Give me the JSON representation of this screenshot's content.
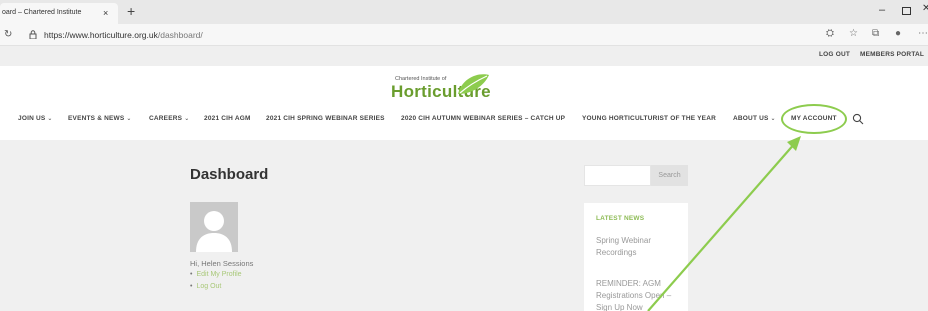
{
  "browser": {
    "tab_title": "oard – Chartered Institute",
    "tab_close": "×",
    "new_tab": "+",
    "url_host": "https://www.horticulture.org.uk",
    "url_path": "/dashboard/",
    "window_min": "–",
    "window_close": "✕"
  },
  "utility_nav": {
    "logout": "LOG OUT",
    "members_portal": "MEMBERS PORTAL"
  },
  "logo": {
    "small_text": "Chartered Institute of",
    "main_text": "Horticulture"
  },
  "main_nav": {
    "items": [
      {
        "label": "JOIN US",
        "chevron": "⌄"
      },
      {
        "label": "EVENTS & NEWS",
        "chevron": "⌄"
      },
      {
        "label": "CAREERS",
        "chevron": "⌄"
      },
      {
        "label": "2021 CIH AGM",
        "chevron": ""
      },
      {
        "label": "2021 CIH SPRING WEBINAR SERIES",
        "chevron": ""
      },
      {
        "label": "2020 CIH AUTUMN WEBINAR SERIES – CATCH UP",
        "chevron": ""
      },
      {
        "label": "YOUNG HORTICULTURIST OF THE YEAR",
        "chevron": ""
      },
      {
        "label": "ABOUT US",
        "chevron": "⌄"
      },
      {
        "label": "MY ACCOUNT",
        "chevron": ""
      }
    ]
  },
  "dashboard": {
    "title": "Dashboard",
    "greeting": "Hi, Helen Sessions",
    "links": [
      "Edit My Profile",
      "Log Out"
    ]
  },
  "sidebar": {
    "search_button": "Search",
    "latest_news_title": "LATEST NEWS",
    "news_items": [
      "Spring Webinar Recordings",
      "REMINDER: AGM Registrations Open – Sign Up Now"
    ]
  },
  "colors": {
    "accent_green": "#8dcc4e",
    "logo_green": "#6a9d2e",
    "link_green": "#a8c878"
  }
}
